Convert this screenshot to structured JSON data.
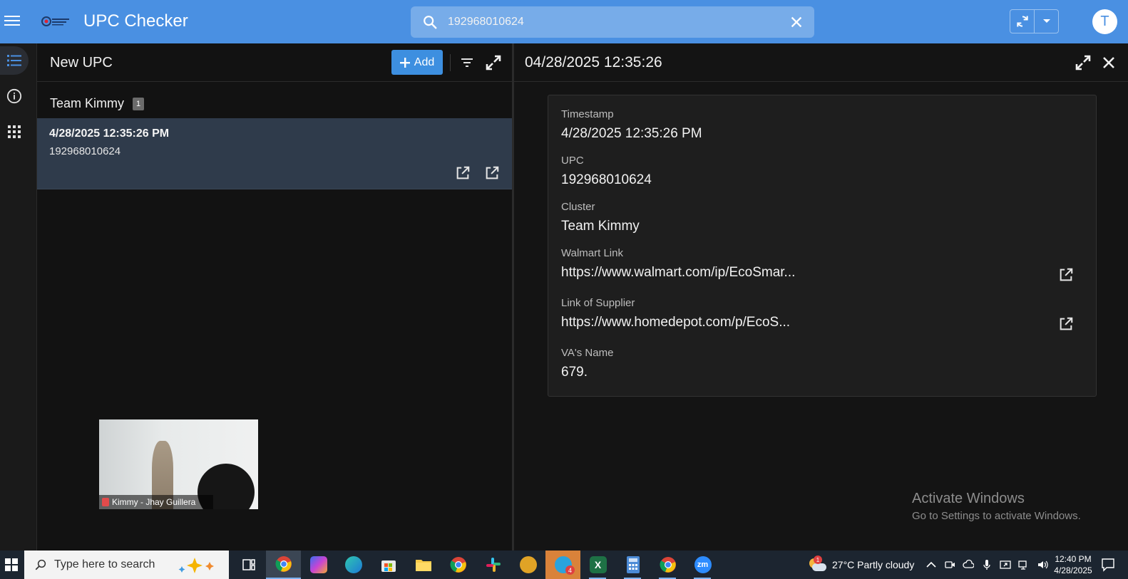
{
  "header": {
    "app_title": "UPC Checker",
    "search_value": "192968010624",
    "avatar_letter": "T",
    "brand_color": "#4a90e2"
  },
  "left_panel": {
    "title": "New UPC",
    "add_label": "Add",
    "group_name": "Team Kimmy",
    "group_count": "1",
    "rows": [
      {
        "timestamp": "4/28/2025 12:35:26 PM",
        "upc": "192968010624"
      }
    ]
  },
  "video": {
    "caption": "Kimmy - Jhay Guillera"
  },
  "detail": {
    "title": "04/28/2025 12:35:26",
    "fields": [
      {
        "label": "Timestamp",
        "value": "4/28/2025 12:35:26 PM"
      },
      {
        "label": "UPC",
        "value": "192968010624"
      },
      {
        "label": "Cluster",
        "value": "Team Kimmy"
      },
      {
        "label": "Walmart Link",
        "value": "https://www.walmart.com/ip/EcoSmar..."
      },
      {
        "label": "Link of Supplier",
        "value": "https://www.homedepot.com/p/EcoS..."
      },
      {
        "label": "VA's Name",
        "value": "679."
      }
    ]
  },
  "watermark": {
    "line1": "Activate Windows",
    "line2": "Go to Settings to activate Windows."
  },
  "taskbar": {
    "search_placeholder": "Type here to search",
    "telegram_badge": "4",
    "weather_badge": "1",
    "weather": "27°C  Partly cloudy",
    "time": "12:40 PM",
    "date": "4/28/2025",
    "apps": [
      "task-view",
      "chrome",
      "copilot",
      "edge",
      "store",
      "file-explorer",
      "chrome",
      "slack",
      "game",
      "telegram",
      "excel",
      "calculator",
      "chrome",
      "zoom"
    ]
  }
}
